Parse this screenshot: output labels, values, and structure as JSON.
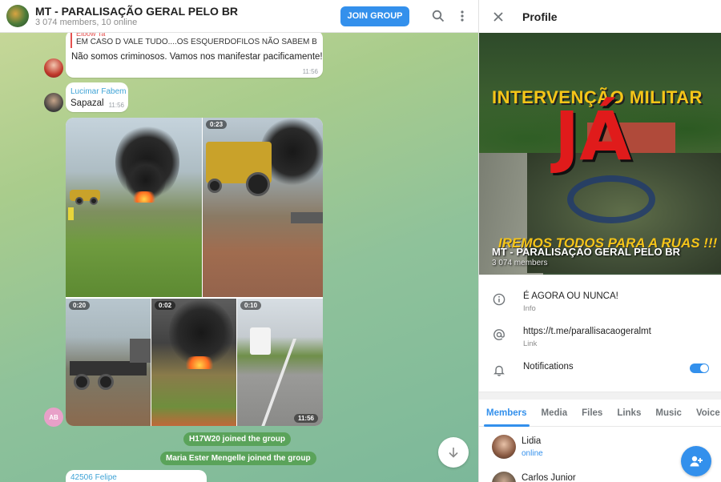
{
  "header": {
    "title": "MT - PARALISAÇÃO GERAL PELO BR",
    "subtitle": "3 074 members, 10 online",
    "join_label": "JOIN GROUP"
  },
  "messages": {
    "m1": {
      "reply_name": "Elbow Ta",
      "reply_text": "EM CASO D VALE TUDO....OS ESQUERDOFILOS NÃO SABEM BRIGAR...",
      "text": "Não somos criminosos. Vamos nos manifestar pacificamente!",
      "time": "11:56"
    },
    "m2": {
      "sender": "Lucimar Fabem",
      "text": "Sapazal",
      "time": "11:56"
    },
    "album": {
      "badges": [
        "0:23",
        "0:20",
        "0:02",
        "0:10"
      ],
      "time": "11:56",
      "avatar_initials": "AB"
    },
    "service": [
      "H17W20 joined the group",
      "Maria Ester Mengelle joined the group"
    ],
    "m3": {
      "sender": "42506 Felipe"
    }
  },
  "profile": {
    "title": "Profile",
    "cover": {
      "headline": "INTERVENÇÃO MILITAR",
      "big_word": "JÁ",
      "slogan": "IREMOS TODOS PARA A RUAS !!!",
      "name": "MT - PARALISAÇÃO GERAL PELO BR",
      "members": "3 074 members"
    },
    "info": [
      {
        "main": "É AGORA OU NUNCA!",
        "sub": "Info"
      },
      {
        "main": "https://t.me/parallisacaogeralmt",
        "sub": "Link"
      },
      {
        "main": "Notifications",
        "sub": "",
        "toggle_on": true
      }
    ],
    "tabs": [
      "Members",
      "Media",
      "Files",
      "Links",
      "Music",
      "Voice"
    ],
    "active_tab": "Members",
    "members": [
      {
        "name": "Lidia",
        "status": "online"
      },
      {
        "name": "Carlos Junior",
        "status": ""
      }
    ]
  },
  "colors": {
    "accent": "#3390ec",
    "service_bg": "#5aa35a",
    "reply_bar": "#e5514f"
  }
}
